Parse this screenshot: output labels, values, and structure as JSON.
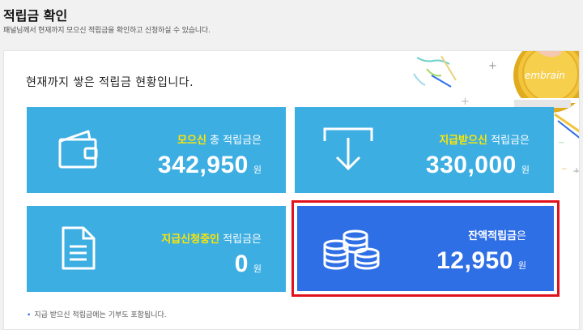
{
  "header": {
    "title": "적립금 확인",
    "subtitle": "패널님께서 현재까지 모으신 적립금을 확인하고 신청하실 수 있습니다."
  },
  "panel": {
    "headline": "현재까지 쌓은 적립금 현황입니다.",
    "coin_brand": "embrain"
  },
  "cards": [
    {
      "icon": "wallet-icon",
      "highlight": "모으신",
      "label_rest": " 총 적립금은",
      "amount": "342,950",
      "unit": "원"
    },
    {
      "icon": "download-arrow-icon",
      "highlight": "지급받으신",
      "label_rest": " 적립금은",
      "amount": "330,000",
      "unit": "원"
    },
    {
      "icon": "document-icon",
      "highlight": "지급신청중인",
      "label_rest": " 적립금은",
      "amount": "0",
      "unit": "원"
    },
    {
      "icon": "coins-icon",
      "highlight": "잔액적립금",
      "label_rest": "은",
      "amount": "12,950",
      "unit": "원"
    }
  ],
  "footnote": "지급 받으신 적립금에는 기부도 포함됩니다.",
  "colors": {
    "card_blue": "#3daee2",
    "card_active": "#2f6fe6",
    "highlight_yellow": "#ffe600",
    "selection_red": "#e1121b"
  }
}
